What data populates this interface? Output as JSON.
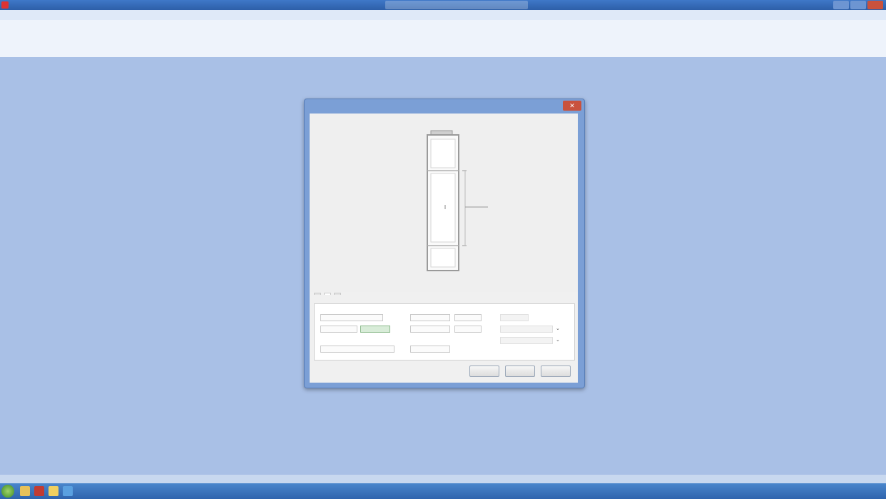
{
  "window": {
    "title": ""
  },
  "menu": {
    "items": [
      "",
      "",
      "",
      "",
      ""
    ]
  },
  "command_lines": [
    "",
    "",
    ""
  ],
  "dialog": {
    "title": "",
    "close_glyph": "✕",
    "preview_label": "",
    "tabs": [
      "",
      "",
      ""
    ],
    "buttons": {
      "ok": "",
      "cancel": "",
      "help": ""
    }
  },
  "statusbar": {
    "text": ""
  },
  "taskbar": {
    "clock": ""
  },
  "colors": {
    "desktop": "#a9c0e6",
    "titlebar": "#2d5fa8",
    "dialog_frame": "#7b9fd6",
    "close_button": "#c9523d",
    "taskbar": "#2f64ad"
  },
  "icons": {
    "app": "app-icon",
    "start": "windows-start-icon"
  }
}
